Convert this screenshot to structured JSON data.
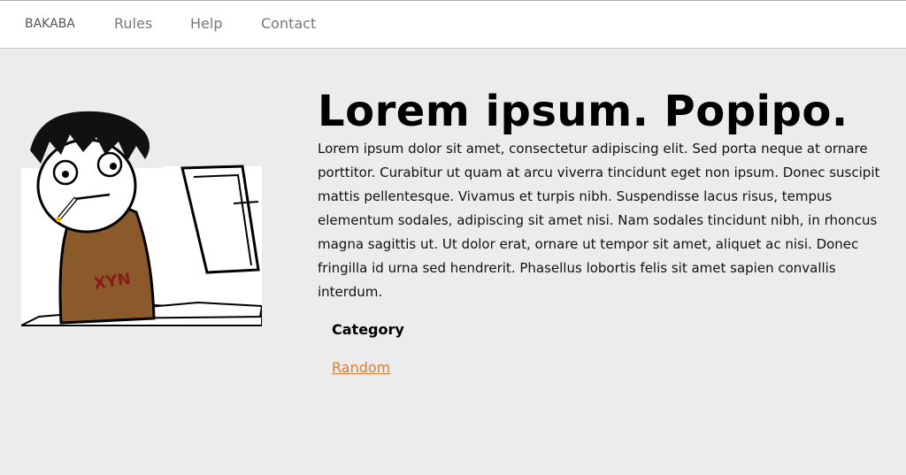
{
  "nav": {
    "brand": "BAKABA",
    "links": [
      "Rules",
      "Help",
      "Contact"
    ]
  },
  "hero": {
    "image_alt": "comic person at computer",
    "shirt_text": "XYN"
  },
  "main": {
    "title": "Lorem ipsum. Popipo.",
    "body": "Lorem ipsum dolor sit amet, consectetur adipiscing elit. Sed porta neque at ornare porttitor. Curabitur ut quam at arcu viverra tincidunt eget non ipsum. Donec suscipit mattis pellentesque. Vivamus et turpis nibh. Suspendisse lacus risus, tempus elementum sodales, adipiscing sit amet nisi. Nam sodales tincidunt nibh, in rhoncus magna sagittis ut. Ut dolor erat, ornare ut tempor sit amet, aliquet ac nisi. Donec fringilla id urna sed hendrerit. Phasellus lobortis felis sit amet sapien convallis interdum.",
    "category_heading": "Category",
    "category_link": "Random"
  },
  "colors": {
    "background": "#ececec",
    "navbar": "#ffffff",
    "link": "#e07a2c"
  }
}
